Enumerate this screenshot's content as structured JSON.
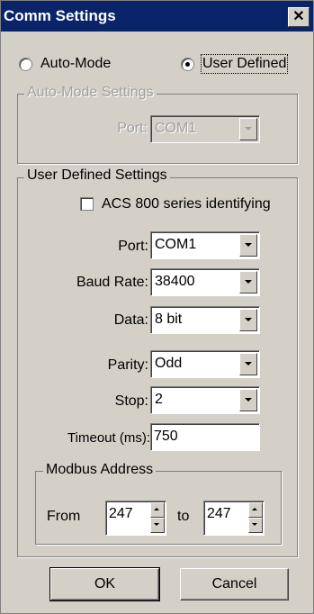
{
  "window": {
    "title": "Comm Settings",
    "close_glyph": "✕"
  },
  "mode": {
    "auto_label": "Auto-Mode",
    "user_label": "User Defined",
    "selected": "User Defined"
  },
  "auto_group": {
    "legend": "Auto-Mode Settings",
    "port_label": "Port:",
    "port_value": "COM1"
  },
  "user_group": {
    "legend": "User Defined Settings",
    "acs_label": "ACS 800 series identifying",
    "acs_checked": false,
    "port_label": "Port:",
    "port_value": "COM1",
    "baud_label": "Baud Rate:",
    "baud_value": "38400",
    "data_label": "Data:",
    "data_value": "8 bit",
    "parity_label": "Parity:",
    "parity_value": "Odd",
    "stop_label": "Stop:",
    "stop_value": "2",
    "timeout_label": "Timeout (ms):",
    "timeout_value": "750"
  },
  "modbus": {
    "legend": "Modbus Address",
    "from_label": "From",
    "from_value": "247",
    "to_label": "to",
    "to_value": "247"
  },
  "buttons": {
    "ok": "OK",
    "cancel": "Cancel"
  }
}
